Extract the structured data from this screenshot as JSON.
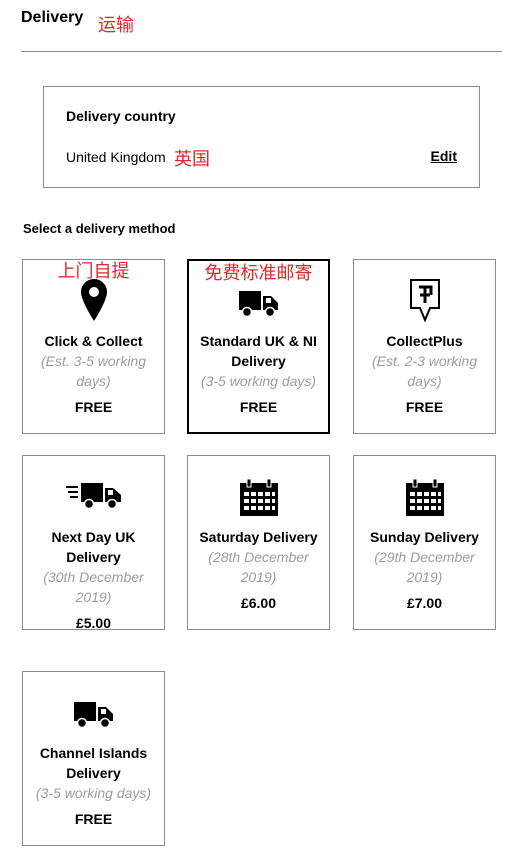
{
  "header": {
    "title": "Delivery",
    "annotation": "运输"
  },
  "country": {
    "label": "Delivery country",
    "value": "United Kingdom",
    "annotation": "英国",
    "edit_label": "Edit"
  },
  "section_title": "Select a delivery method",
  "methods": [
    {
      "name": "Click & Collect",
      "est": "(Est. 3-5 working days)",
      "price": "FREE",
      "icon": "map-pin-icon",
      "annotation": "上门自提"
    },
    {
      "name": "Standard UK & NI Delivery",
      "est": "(3-5 working days)",
      "price": "FREE",
      "icon": "truck-icon",
      "annotation": "免费标准邮寄",
      "selected": true
    },
    {
      "name": "CollectPlus",
      "est": "(Est. 2-3 working days)",
      "price": "FREE",
      "icon": "collectplus-icon"
    },
    {
      "name": "Next Day UK Delivery",
      "est": "(30th December 2019)",
      "price": "£5.00",
      "icon": "fast-truck-icon"
    },
    {
      "name": "Saturday Delivery",
      "est": "(28th December 2019)",
      "price": "£6.00",
      "icon": "calendar-icon"
    },
    {
      "name": "Sunday Delivery",
      "est": "(29th December 2019)",
      "price": "£7.00",
      "icon": "calendar-icon"
    },
    {
      "name": "Channel Islands Delivery",
      "est": "(3-5 working days)",
      "price": "FREE",
      "icon": "truck-icon"
    }
  ]
}
